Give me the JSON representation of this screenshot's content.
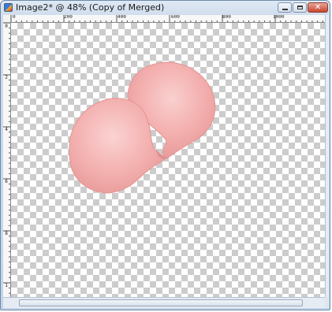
{
  "window": {
    "title": "Image2* @ 48% (Copy of Merged)",
    "icons": {
      "app": "paint-shop-pro-icon",
      "minimize": "minimize-icon",
      "maximize": "maximize-icon",
      "close": "close-icon"
    },
    "close_glyph": "✕"
  },
  "rulers": {
    "horizontal_labels": [
      "0",
      "200",
      "400",
      "600",
      "800",
      "1000"
    ],
    "vertical_labels": [
      "0",
      "2",
      "4",
      "6",
      "8",
      "1"
    ]
  },
  "canvas": {
    "background": "transparency-checkerboard",
    "layer_content": "two pink petal shapes",
    "colors": {
      "petal_light": "#f8c7c6",
      "petal_mid": "#f2a8a8",
      "petal_edge": "#e08f8f"
    }
  }
}
